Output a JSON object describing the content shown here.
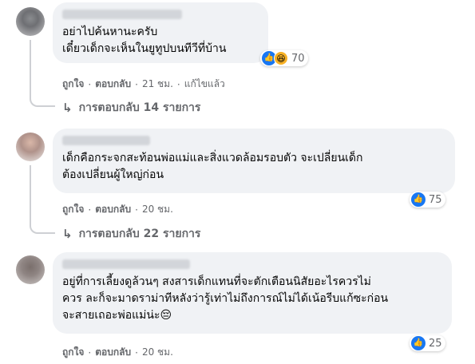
{
  "comments": [
    {
      "text": "อย่าไปค้นหานะครับ\nเดี๋ยวเด็กจะเห็นในยูทูปบนทีวีที่บ้าน",
      "reaction_count": "70",
      "reactions": [
        "like",
        "haha"
      ],
      "like_label": "ถูกใจ",
      "reply_label": "ตอบกลับ",
      "time": "21 ชม.",
      "edited": "แก้ไขแล้ว",
      "replies_label": "การตอบกลับ 14 รายการ"
    },
    {
      "text": "เด็กคือกระจกสะท้อนพ่อแม่และสิ่งแวดล้อมรอบตัว จะเปลี่ยนเด็ก\nต้องเปลี่ยนผู้ใหญ่ก่อน",
      "reaction_count": "75",
      "reactions": [
        "like"
      ],
      "like_label": "ถูกใจ",
      "reply_label": "ตอบกลับ",
      "time": "20 ชม.",
      "replies_label": "การตอบกลับ 22 รายการ"
    },
    {
      "text": "อยู่ที่การเลี้ยงดูล้วนๆ สงสารเด็กแทนที่จะตักเตือนนิสัยอะไรควรไม่\nควร ละก็จะมาดราม่าทีหลังว่ารู้เท่าไม่ถึงการณ์ไม่ได้เน้อรีบแก้ซะก่อน\nจะสายเถอะพ่อแม่น่ะ😔",
      "reaction_count": "25",
      "reactions": [
        "like"
      ],
      "like_label": "ถูกใจ",
      "reply_label": "ตอบกลับ",
      "time": "20 ชม."
    }
  ],
  "icons": {
    "like": "thumbs-up-icon",
    "haha": "haha-emoji-icon",
    "reply_arrow": "reply-arrow-icon"
  },
  "colors": {
    "like_blue": "#1877f2",
    "bubble_bg": "#f0f2f5",
    "muted_text": "#65676b"
  }
}
